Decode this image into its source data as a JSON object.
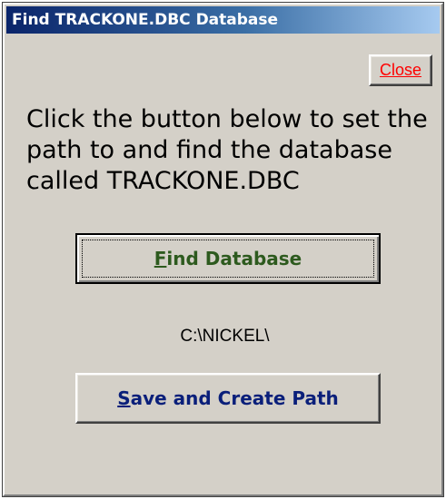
{
  "window": {
    "title": "Find TRACKONE.DBC Database"
  },
  "close_button": {
    "accel": "C",
    "rest": "lose"
  },
  "message": {
    "line1": "Click the button below to set the",
    "line2": "path to and find the database",
    "line3": "called TRACKONE.DBC"
  },
  "find_button": {
    "accel": "F",
    "rest": "ind Database"
  },
  "path": {
    "value": "C:\\NICKEL\\"
  },
  "save_button": {
    "accel": "S",
    "rest": "ave and Create Path"
  },
  "colors": {
    "title_bar_start": "#0a246a",
    "title_bar_end": "#a6caf0",
    "window_face": "#d4d0c8",
    "close_text": "#ff0000",
    "find_text": "#2d5a1e",
    "save_text": "#0a1f7a"
  }
}
